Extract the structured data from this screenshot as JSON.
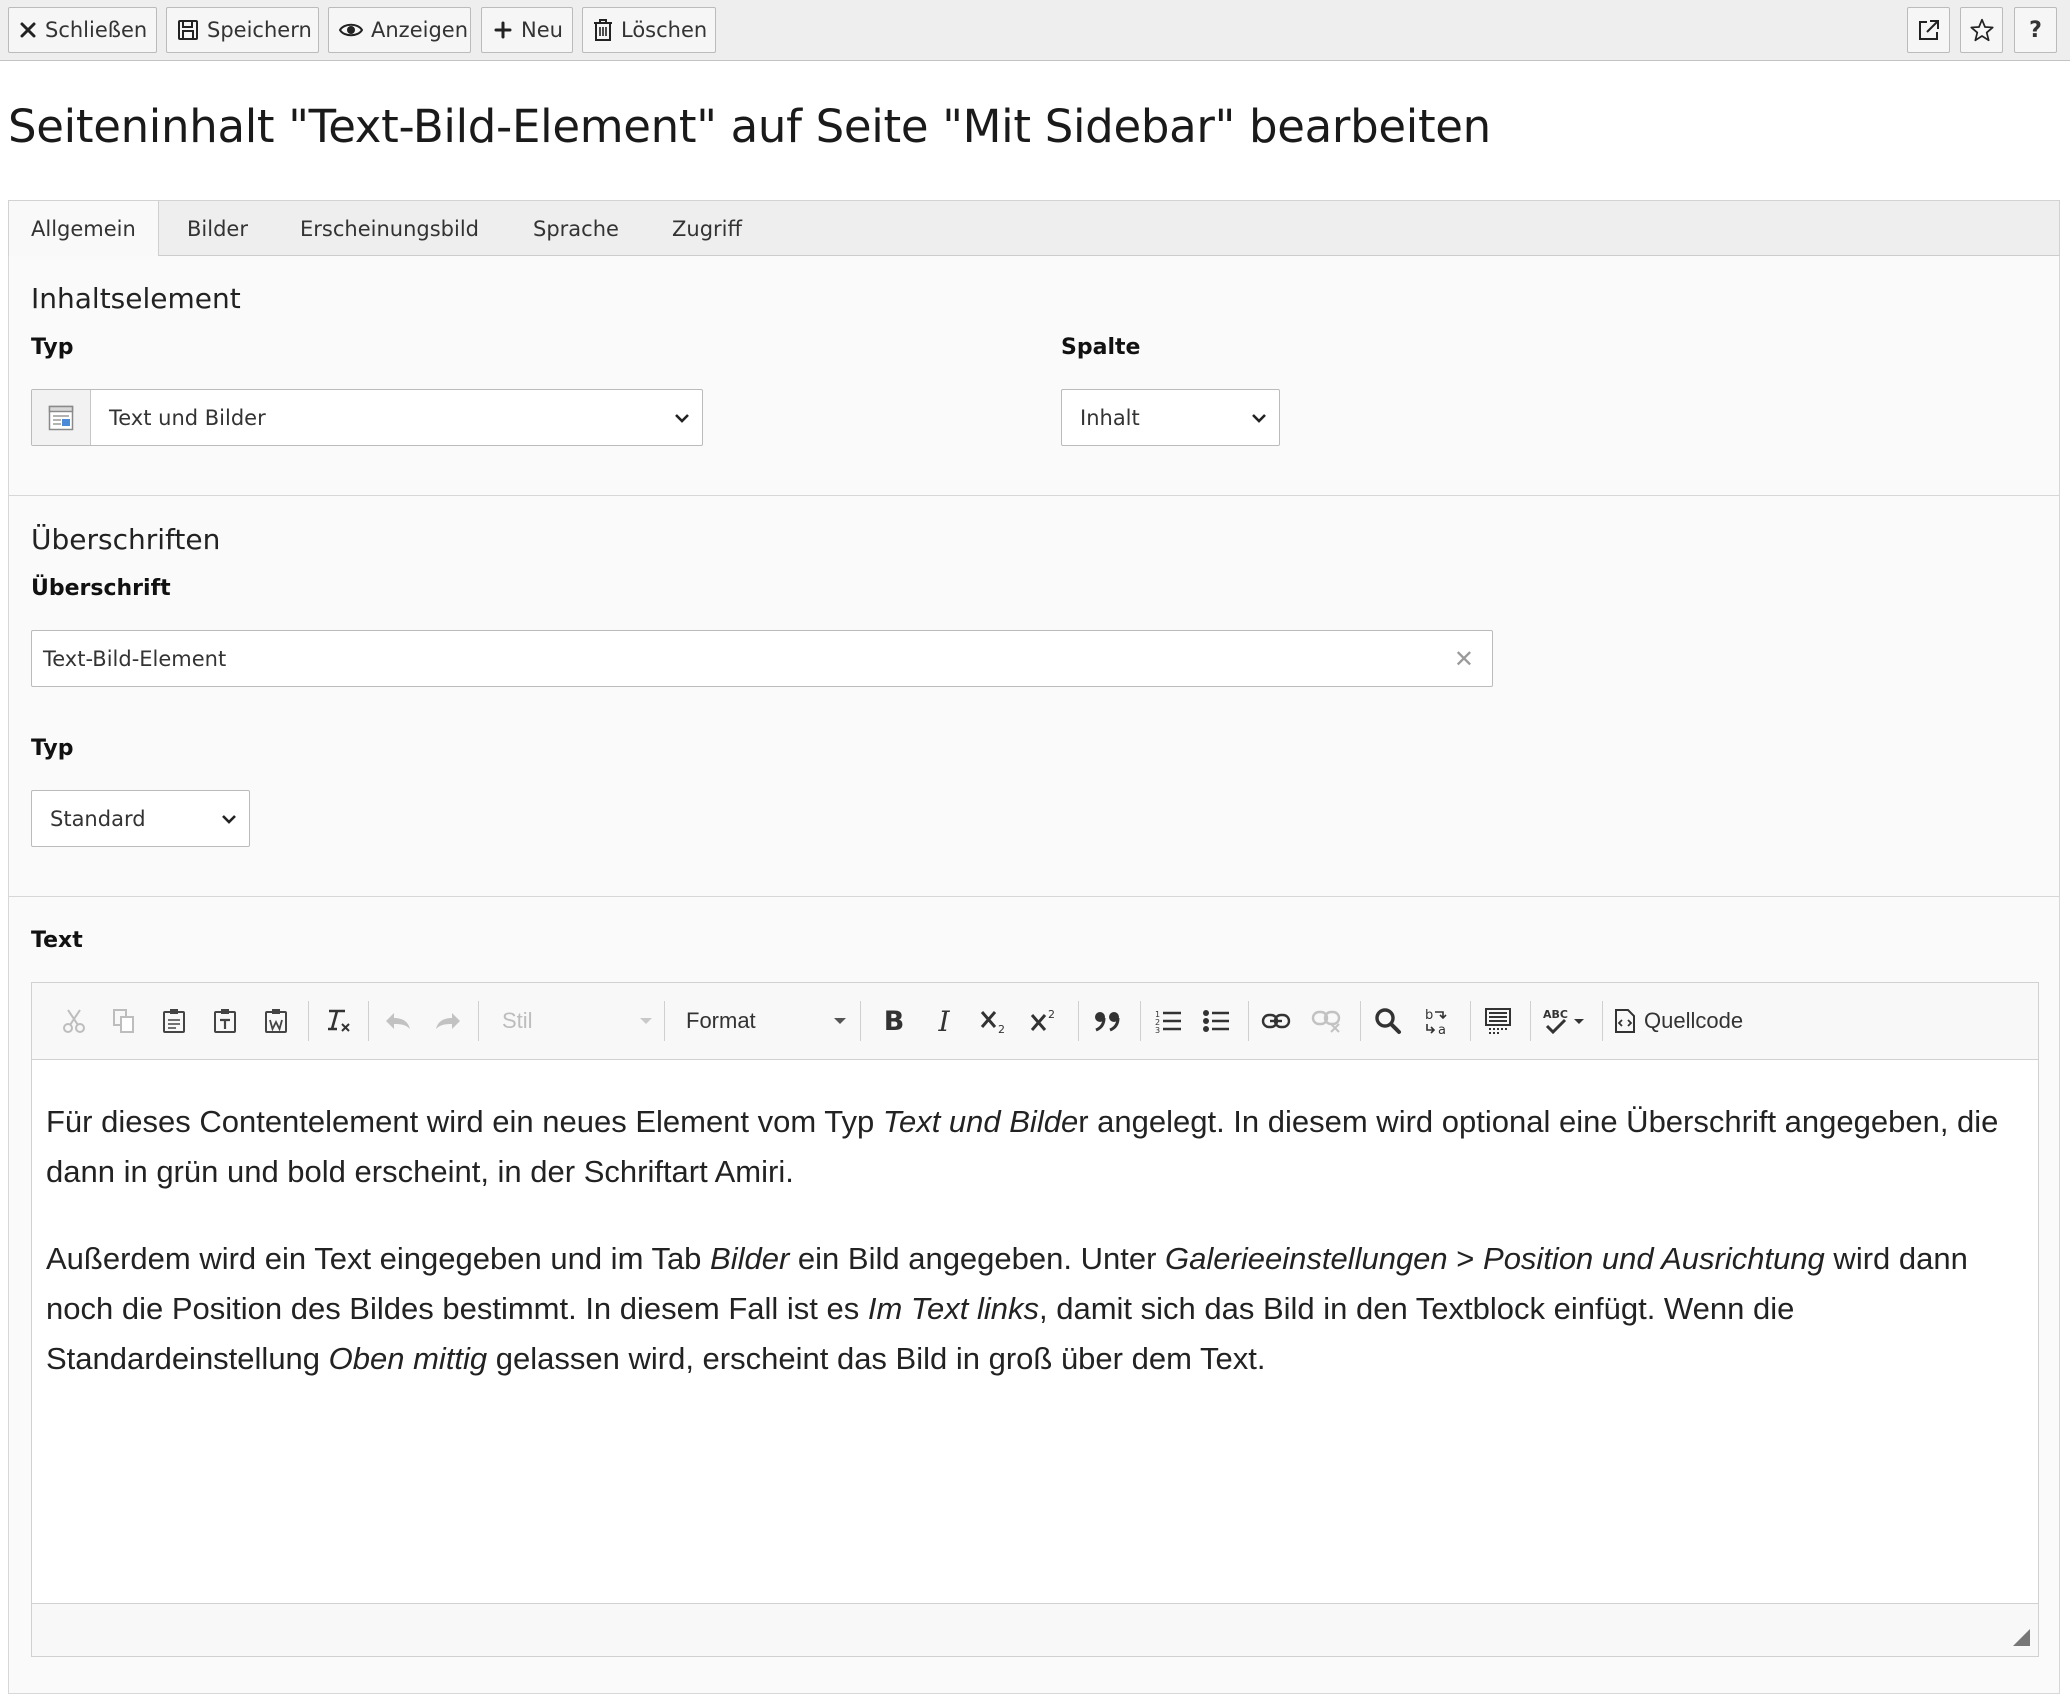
{
  "toolbar": {
    "close_label": "Schließen",
    "save_label": "Speichern",
    "view_label": "Anzeigen",
    "new_label": "Neu",
    "delete_label": "Löschen",
    "help_label": "?"
  },
  "page_title": "Seiteninhalt \"Text-Bild-Element\" auf Seite \"Mit Sidebar\" bearbeiten",
  "tabs": [
    {
      "label": "Allgemein",
      "active": true
    },
    {
      "label": "Bilder"
    },
    {
      "label": "Erscheinungsbild"
    },
    {
      "label": "Sprache"
    },
    {
      "label": "Zugriff"
    }
  ],
  "content_element": {
    "heading": "Inhaltselement",
    "type_label": "Typ",
    "type_value": "Text und Bilder",
    "column_label": "Spalte",
    "column_value": "Inhalt"
  },
  "headers": {
    "heading": "Überschriften",
    "header_label": "Überschrift",
    "header_value": "Text-Bild-Element",
    "header_type_label": "Typ",
    "header_type_value": "Standard"
  },
  "text": {
    "label": "Text",
    "style_combo": "Stil",
    "format_combo": "Format",
    "source_label": "Quellcode",
    "p1_a": "Für dieses Contentelement wird ein neues Element vom Typ ",
    "p1_i1": "Text und Bilde",
    "p1_b": "r angelegt. In diesem wird optional eine Überschrift angegeben, die dann in grün und bold erscheint, in der Schriftart Amiri.",
    "p2_a": "Außerdem wird ein Text eingegeben und im Tab ",
    "p2_i1": "Bilder",
    "p2_b": " ein Bild angegeben. Unter ",
    "p2_i2": "Galerieeinstellungen",
    "p2_c": " > ",
    "p2_i3": "Position und Ausrichtung",
    "p2_d": " wird dann noch die Position des Bildes bestimmt. In diesem Fall ist es ",
    "p2_i4": "Im Text links",
    "p2_e": ", damit sich das Bild in den Textblock einfügt. Wenn die Standardeinstellung ",
    "p2_i5": "Oben mittig",
    "p2_f": " gelassen wird, erscheint das Bild in groß über dem Text."
  },
  "icons": {
    "close": "close-icon",
    "save": "save-icon",
    "view": "eye-icon",
    "new": "plus-icon",
    "delete": "trash-icon",
    "open_new_window": "external-link-icon",
    "bookmark": "star-icon",
    "select_chevron": "chevron-down-icon"
  }
}
